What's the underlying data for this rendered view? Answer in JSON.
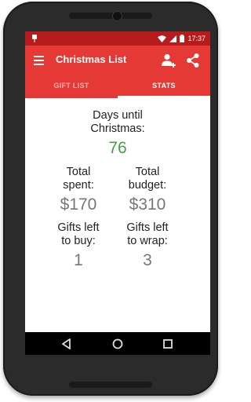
{
  "status_bar": {
    "time": "17:37"
  },
  "app_bar": {
    "title": "Christmas List",
    "menu_icon": "hamburger-menu-icon",
    "add_person_icon": "add-person-icon",
    "share_icon": "share-icon"
  },
  "tabs": [
    {
      "label": "GIFT LIST",
      "active": false
    },
    {
      "label": "STATS",
      "active": true
    }
  ],
  "stats": {
    "days_label": "Days until\nChristmas:",
    "days_value": "76",
    "spent_label": "Total\nspent:",
    "spent_value": "$170",
    "budget_label": "Total\nbudget:",
    "budget_value": "$310",
    "buy_label": "Gifts left\nto buy:",
    "buy_value": "1",
    "wrap_label": "Gifts left\nto wrap:",
    "wrap_value": "3"
  },
  "colors": {
    "primary": "#e53935",
    "primary_dark": "#b71c1c",
    "accent_value": "#43a047",
    "stat_value": "#777777"
  }
}
